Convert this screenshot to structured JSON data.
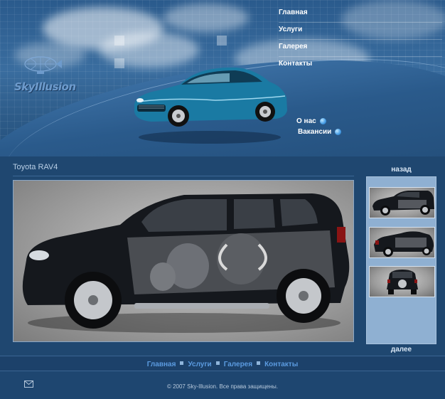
{
  "brand": {
    "logo_text": "SkyIllusion"
  },
  "top_nav": {
    "items": [
      {
        "label": "Главная"
      },
      {
        "label": "Услуги"
      },
      {
        "label": "Галерея"
      },
      {
        "label": "Контакты"
      }
    ]
  },
  "side_links": {
    "about": "О нас",
    "vacancies": "Вакансии"
  },
  "content": {
    "title": "Toyota RAV4"
  },
  "thumbs": {
    "prev_label": "назад",
    "next_label": "далее"
  },
  "footer": {
    "nav": [
      {
        "label": "Главная"
      },
      {
        "label": "Услуги"
      },
      {
        "label": "Галерея"
      },
      {
        "label": "Контакты"
      }
    ],
    "copyright": "© 2007 Sky-Illusion. Все права защищены."
  },
  "icons": {
    "logo": "airship-icon",
    "bullet": "blue-dot-icon",
    "mail": "mail-icon"
  },
  "colors": {
    "background": "#1f4770",
    "accent_link": "#5b9be0",
    "thumb_panel": "#8fb0d2"
  }
}
